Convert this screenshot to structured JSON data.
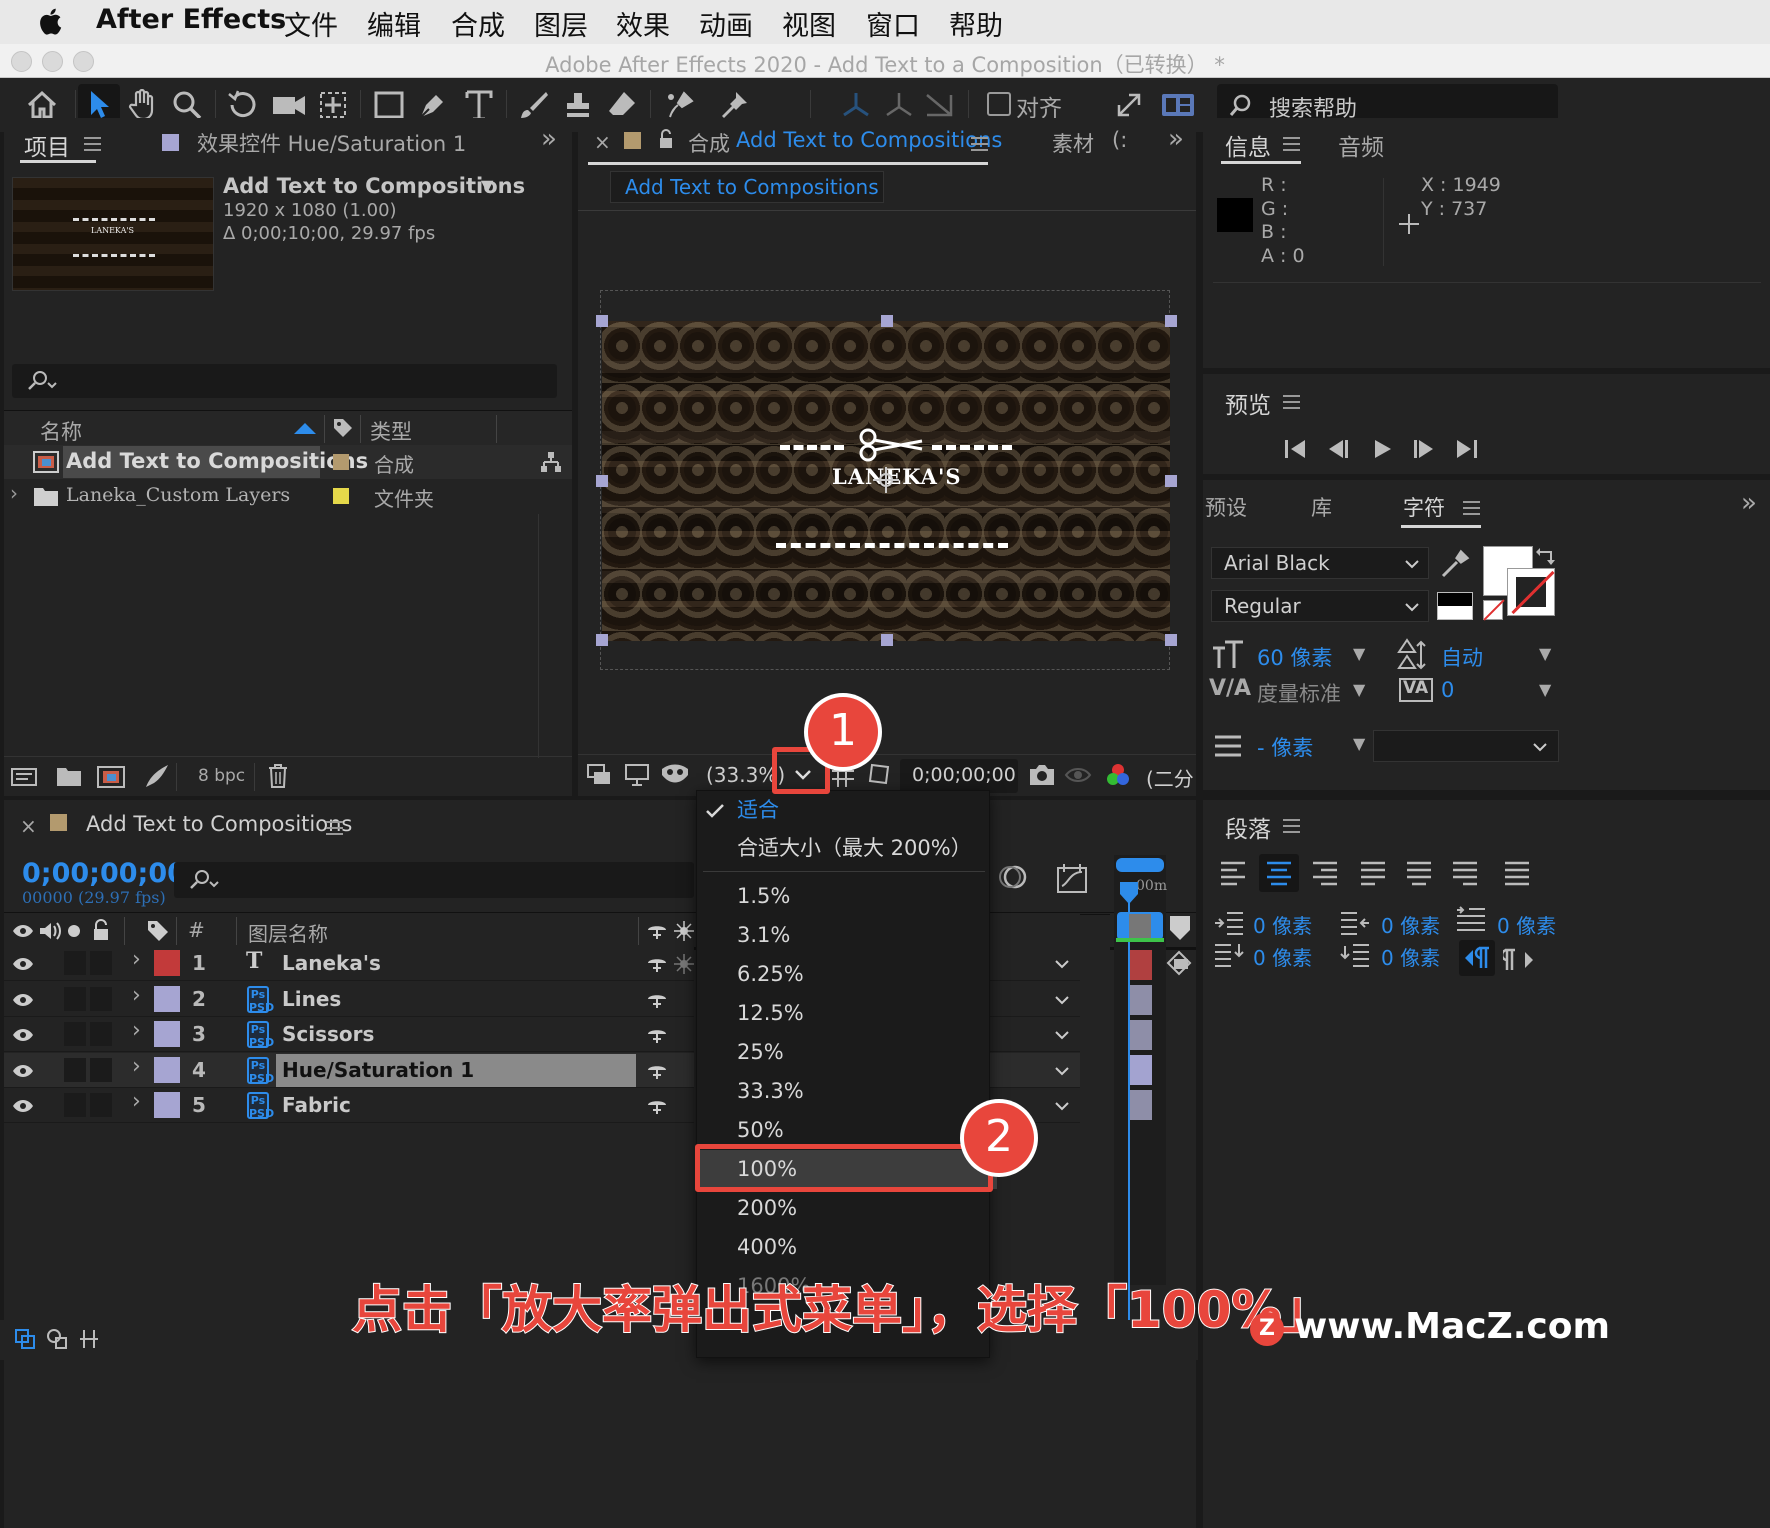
{
  "menubar": {
    "app": "After Effects",
    "items": [
      "文件",
      "编辑",
      "合成",
      "图层",
      "效果",
      "动画",
      "视图",
      "窗口",
      "帮助"
    ]
  },
  "window_title": "Adobe After Effects 2020 - Add Text to a Composition（已转换） *",
  "toolbar": {
    "align_label": "对齐",
    "search_placeholder": "搜索帮助"
  },
  "project_panel": {
    "tab_project": "项目",
    "tab_effects": "效果控件 Hue/Saturation 1",
    "comp_name": "Add Text to Compositions",
    "comp_size": "1920 x 1080 (1.00)",
    "comp_duration": "Δ 0;00;10;00, 29.97 fps",
    "thumb_logo": "LANEKA'S",
    "col_name": "名称",
    "col_type": "类型",
    "items": [
      {
        "name": "Add Text to Compositions",
        "type": "合成",
        "color": "#b39a6e"
      },
      {
        "name": "Laneka_Custom Layers",
        "type": "文件夹",
        "color": "#e5d84a"
      }
    ],
    "bpc": "8 bpc"
  },
  "comp_panel": {
    "tab_prefix": "合成",
    "tab_name": "Add Text to Compositions",
    "tab_footage": "素材",
    "tab_footage_extra": "(:",
    "breadcrumb": "Add Text to Compositions",
    "logo_text": "LANEKA'S",
    "zoom": "(33.3%)",
    "timecode": "0;00;00;00",
    "resolution": "(二分"
  },
  "info_panel": {
    "tab_info": "信息",
    "tab_audio": "音频",
    "r_label": "R :",
    "g_label": "G :",
    "b_label": "B :",
    "a_label": "A :  0",
    "x_label": "X : 1949",
    "y_label": "Y :  737"
  },
  "preview_panel": {
    "title": "预览"
  },
  "character_panel": {
    "tab_presets": "预设",
    "tab_library": "库",
    "tab_character": "字符",
    "font": "Arial Black",
    "style": "Regular",
    "size": "60 像素",
    "leading": "自动",
    "kerning": "度量标准",
    "tracking": "0",
    "stroke": "- 像素"
  },
  "paragraph_panel": {
    "title": "段落",
    "indent_left": "0 像素",
    "indent_right": "0 像素",
    "indent_first": "0 像素",
    "space_before": "0 像素",
    "space_after": "0 像素"
  },
  "timeline": {
    "tab": "Add Text to Compositions",
    "timecode": "0;00;00;00",
    "frames": "00000 (29.97 fps)",
    "col_num": "#",
    "col_layer": "图层名称",
    "layers": [
      {
        "num": "1",
        "name": "Laneka's",
        "kind": "text",
        "color": "#c23a3a"
      },
      {
        "num": "2",
        "name": "Lines",
        "kind": "ps",
        "color": "#a6a5d2"
      },
      {
        "num": "3",
        "name": "Scissors",
        "kind": "ps",
        "color": "#a6a5d2"
      },
      {
        "num": "4",
        "name": "Hue/Saturation 1",
        "kind": "ps",
        "color": "#a6a5d2"
      },
      {
        "num": "5",
        "name": "Fabric",
        "kind": "ps",
        "color": "#a6a5d2"
      }
    ],
    "ruler_label": "00m"
  },
  "zoom_menu": {
    "checked": "适合",
    "fit_max": "合适大小（最大 200%）",
    "options": [
      "1.5%",
      "3.1%",
      "6.25%",
      "12.5%",
      "25%",
      "33.3%",
      "50%",
      "100%",
      "200%",
      "400%"
    ],
    "partial": "1600%"
  },
  "annotations": {
    "step1": "1",
    "step2": "2",
    "caption": "点击「放大率弹出式菜单」，选择「100%」",
    "watermark": "www.MacZ.com",
    "watermark_logo": "Z"
  },
  "colors": {
    "accent_blue": "#2d8ceb",
    "highlight_red": "#e8463c",
    "panel_bg": "#232323"
  }
}
